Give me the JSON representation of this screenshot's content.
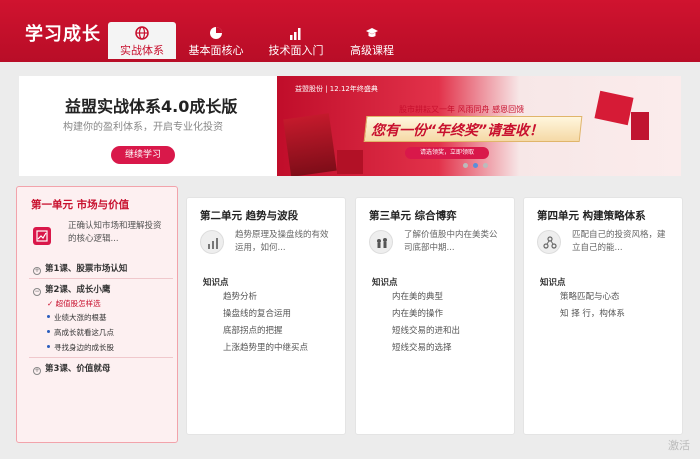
{
  "app": {
    "title": "学习成长"
  },
  "tabs": [
    {
      "label": "实战体系",
      "active": true,
      "icon": "globe-icon"
    },
    {
      "label": "基本面核心",
      "active": false,
      "icon": "pie-chart-icon"
    },
    {
      "label": "技术面入门",
      "active": false,
      "icon": "bar-chart-icon"
    },
    {
      "label": "高级课程",
      "active": false,
      "icon": "graduation-cap-icon"
    }
  ],
  "banner": {
    "title": "益盟实战体系4.0成长版",
    "subtitle": "构建你的盈利体系，开启专业化投资",
    "continue_label": "继续学习"
  },
  "ad": {
    "logo_text": "益盟股份 | 12.12年终盛典",
    "line1": "股市耕耘又一年 风雨同舟 感恩回馈",
    "headline": "您有一份“年终奖”请查收！",
    "button": "请选领奖，立即领取"
  },
  "units": [
    {
      "title": "第一单元 市场与价值",
      "desc": "正确认知市场和理解投资的核心逻辑...",
      "lessons": [
        {
          "label": "第1课、股票市场认知"
        },
        {
          "label": "第2课、成长小鹰",
          "subs": [
            {
              "label": "超值股怎样选",
              "current": true
            },
            {
              "label": "业绩大涨的根基",
              "current": false
            },
            {
              "label": "高成长就看这几点",
              "current": false
            },
            {
              "label": "寻找身边的成长股",
              "current": false
            }
          ]
        },
        {
          "label": "第3课、价值就母"
        }
      ]
    },
    {
      "title": "第二单元 趋势与波段",
      "desc": "趋势原理及操盘线的有效运用，如何...",
      "kp_label": "知识点",
      "points": [
        "趋势分析",
        "操盘线的复合运用",
        "底部拐点的把握",
        "上涨趋势里的中继买点"
      ],
      "icon": "chart-trend-icon"
    },
    {
      "title": "第三单元 综合博弈",
      "desc": "了解价值股中内在美类公司底部中期...",
      "kp_label": "知识点",
      "points": [
        "内在美的典型",
        "内在美的操作",
        "短线交易的进和出",
        "短线交易的选择"
      ],
      "icon": "chess-icon"
    },
    {
      "title": "第四单元 构建策略体系",
      "desc": "匹配自己的投资风格，建立自己的能...",
      "kp_label": "知识点",
      "points": [
        "策略匹配与心态",
        "知 择 行，构体系"
      ],
      "icon": "network-icon"
    }
  ],
  "watermark": "激活"
}
